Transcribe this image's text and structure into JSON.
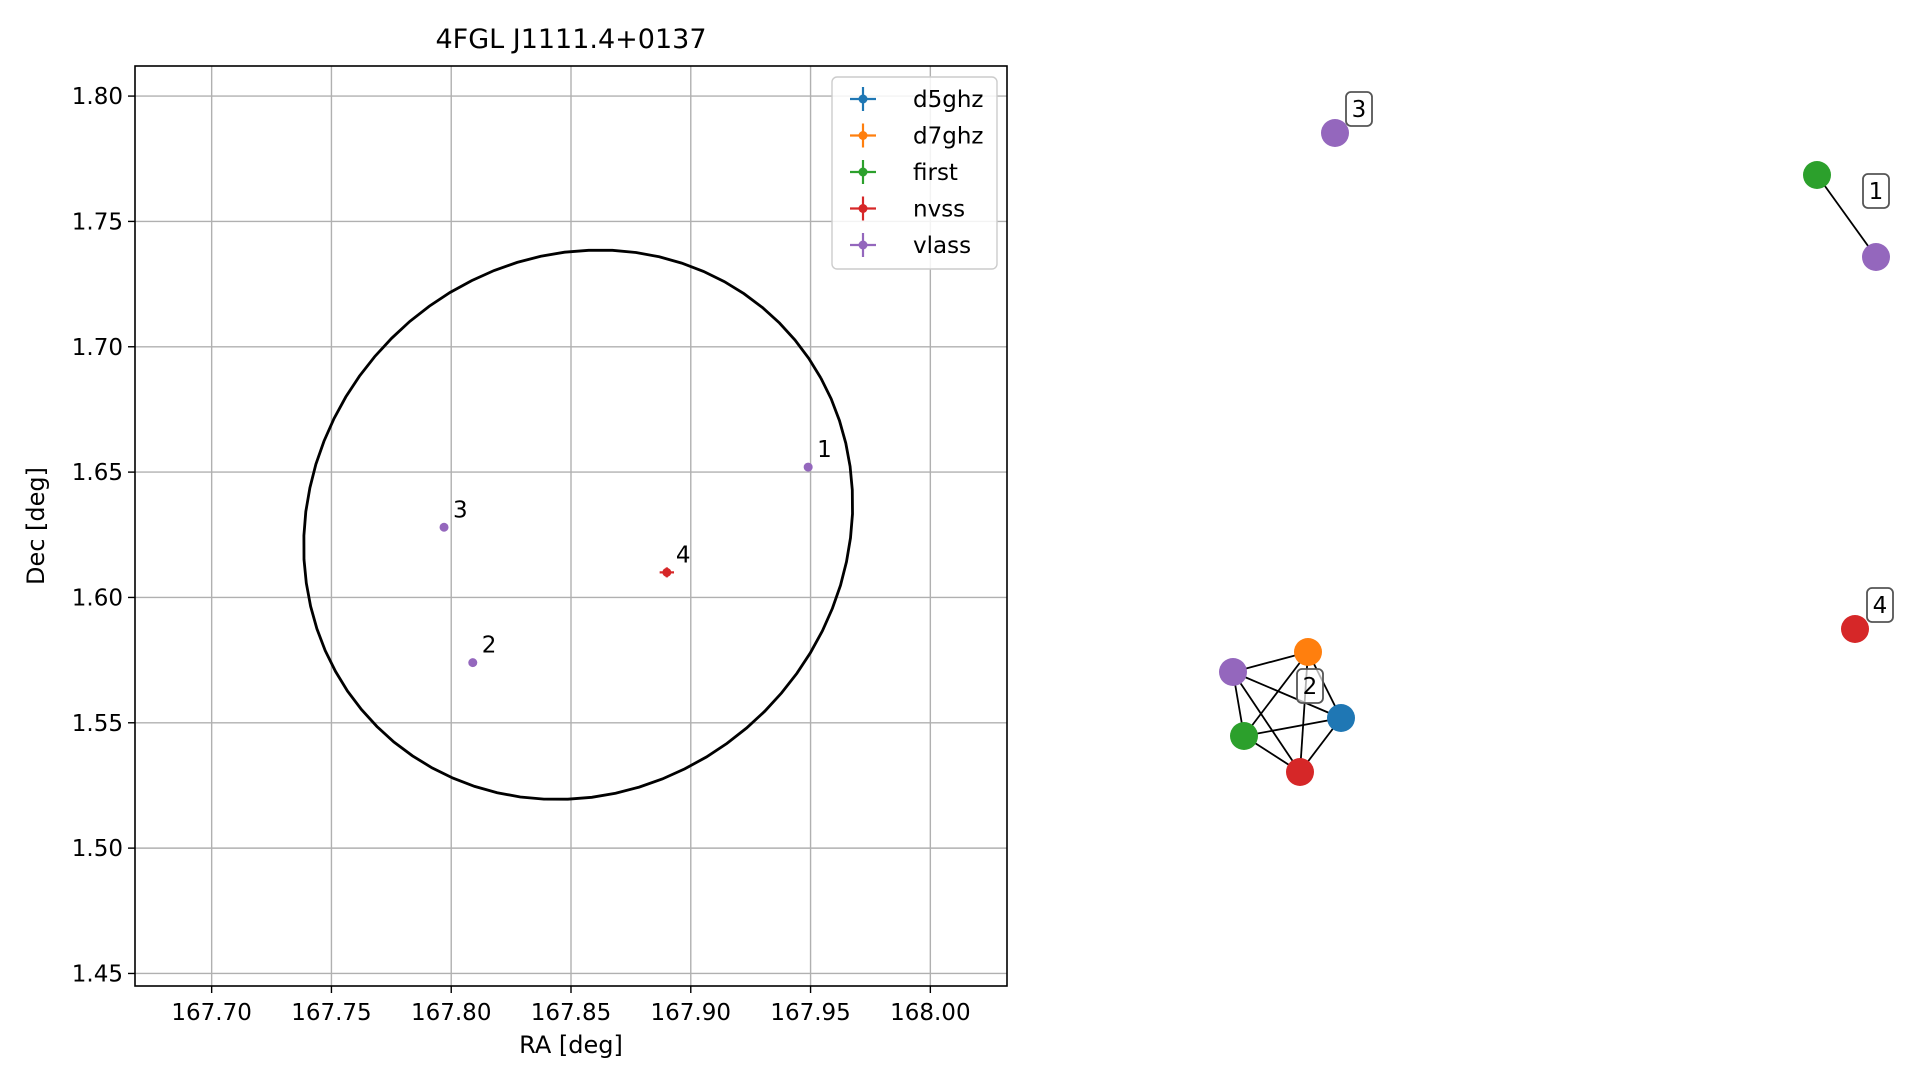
{
  "colors": {
    "d5ghz": "#1f77b4",
    "d7ghz": "#ff7f0e",
    "first": "#2ca02c",
    "nvss": "#d62728",
    "vlass": "#9467bd",
    "grid": "#b0b0b0"
  },
  "chart_data": [
    {
      "type": "scatter",
      "title": "4FGL J1111.4+0137",
      "xlabel": "RA [deg]",
      "ylabel": "Dec [deg]",
      "xlim": [
        167.668,
        168.032
      ],
      "ylim": [
        1.445,
        1.812
      ],
      "xticks": [
        "167.70",
        "167.75",
        "167.80",
        "167.85",
        "167.90",
        "167.95",
        "168.00"
      ],
      "xtick_values": [
        167.7,
        167.75,
        167.8,
        167.85,
        167.9,
        167.95,
        168.0
      ],
      "yticks": [
        "1.45",
        "1.50",
        "1.55",
        "1.60",
        "1.65",
        "1.70",
        "1.75",
        "1.80"
      ],
      "ytick_values": [
        1.45,
        1.5,
        1.55,
        1.6,
        1.65,
        1.7,
        1.75,
        1.8
      ],
      "grid": true,
      "legend_position": "top-right",
      "legend": [
        "d5ghz",
        "d7ghz",
        "first",
        "nvss",
        "vlass"
      ],
      "ellipse": {
        "center": [
          167.853,
          1.629
        ],
        "semi_major": 0.117,
        "semi_minor": 0.107,
        "angle_deg": 30
      },
      "points": [
        {
          "label": "1",
          "series": "vlass",
          "ra": 167.949,
          "dec": 1.652,
          "ra_err": 0.001,
          "dec_err": 0.001
        },
        {
          "label": "2",
          "series": "vlass",
          "ra": 167.809,
          "dec": 1.574,
          "ra_err": 0.001,
          "dec_err": 0.001
        },
        {
          "label": "3",
          "series": "vlass",
          "ra": 167.797,
          "dec": 1.628,
          "ra_err": 0.001,
          "dec_err": 0.001
        },
        {
          "label": "4",
          "series": "nvss",
          "ra": 167.89,
          "dec": 1.61,
          "ra_err": 0.003,
          "dec_err": 0.002
        }
      ]
    },
    {
      "type": "network",
      "groups": [
        {
          "label": "1",
          "nodes": [
            "first",
            "vlass"
          ]
        },
        {
          "label": "2",
          "nodes": [
            "vlass",
            "d7ghz",
            "d5ghz",
            "first",
            "nvss"
          ]
        },
        {
          "label": "3",
          "nodes": [
            "vlass"
          ]
        },
        {
          "label": "4",
          "nodes": [
            "nvss"
          ]
        }
      ]
    }
  ]
}
